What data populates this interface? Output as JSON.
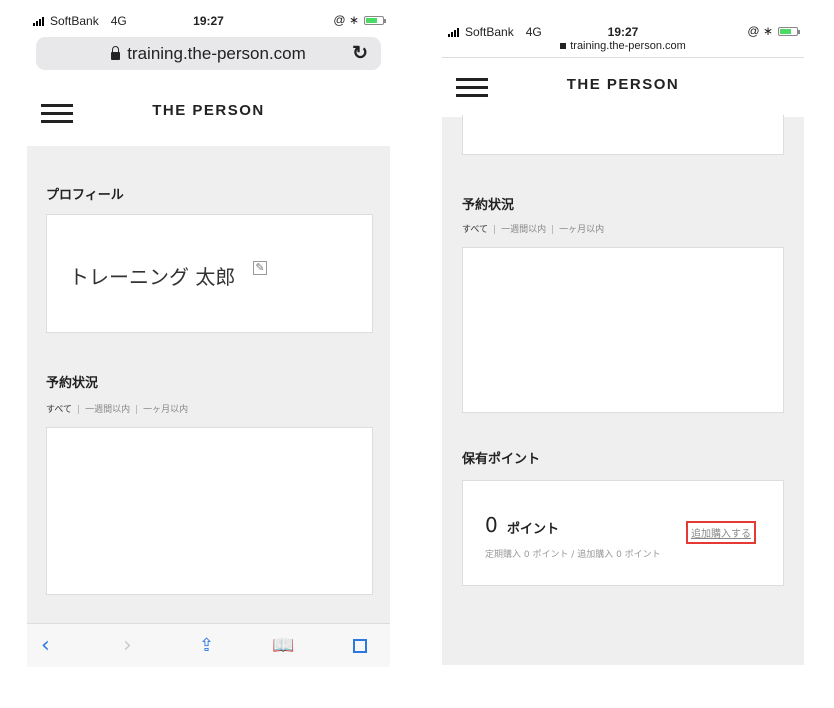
{
  "status": {
    "carrier": "SoftBank",
    "network": "4G",
    "time": "19:27",
    "indicators": "@ ∗"
  },
  "browser": {
    "url": "training.the-person.com",
    "reload_icon": "reload-icon"
  },
  "site": {
    "brand": "THE PERSON",
    "menu_icon": "hamburger-icon"
  },
  "profile": {
    "title": "プロフィール",
    "name": "トレーニング 太郎",
    "edit_icon": "edit-icon"
  },
  "reservation": {
    "title": "予約状況",
    "filters": [
      "すべて",
      "一週間以内",
      "一ヶ月以内"
    ],
    "sep": "|"
  },
  "points": {
    "title": "保有ポイント",
    "value": "0",
    "unit": "ポイント",
    "add_link": "追加購入する",
    "detail": "定期購入 0 ポイント / 追加購入 0 ポイント"
  },
  "toolbar": {
    "back": "‹",
    "forward": "›",
    "share_icon": "share-icon",
    "bookmarks_icon": "book-icon",
    "tabs_icon": "tabs-icon"
  },
  "colors": {
    "highlight": "#e53935",
    "link_blue": "#2a7ae2",
    "content_bg": "#efefef"
  }
}
